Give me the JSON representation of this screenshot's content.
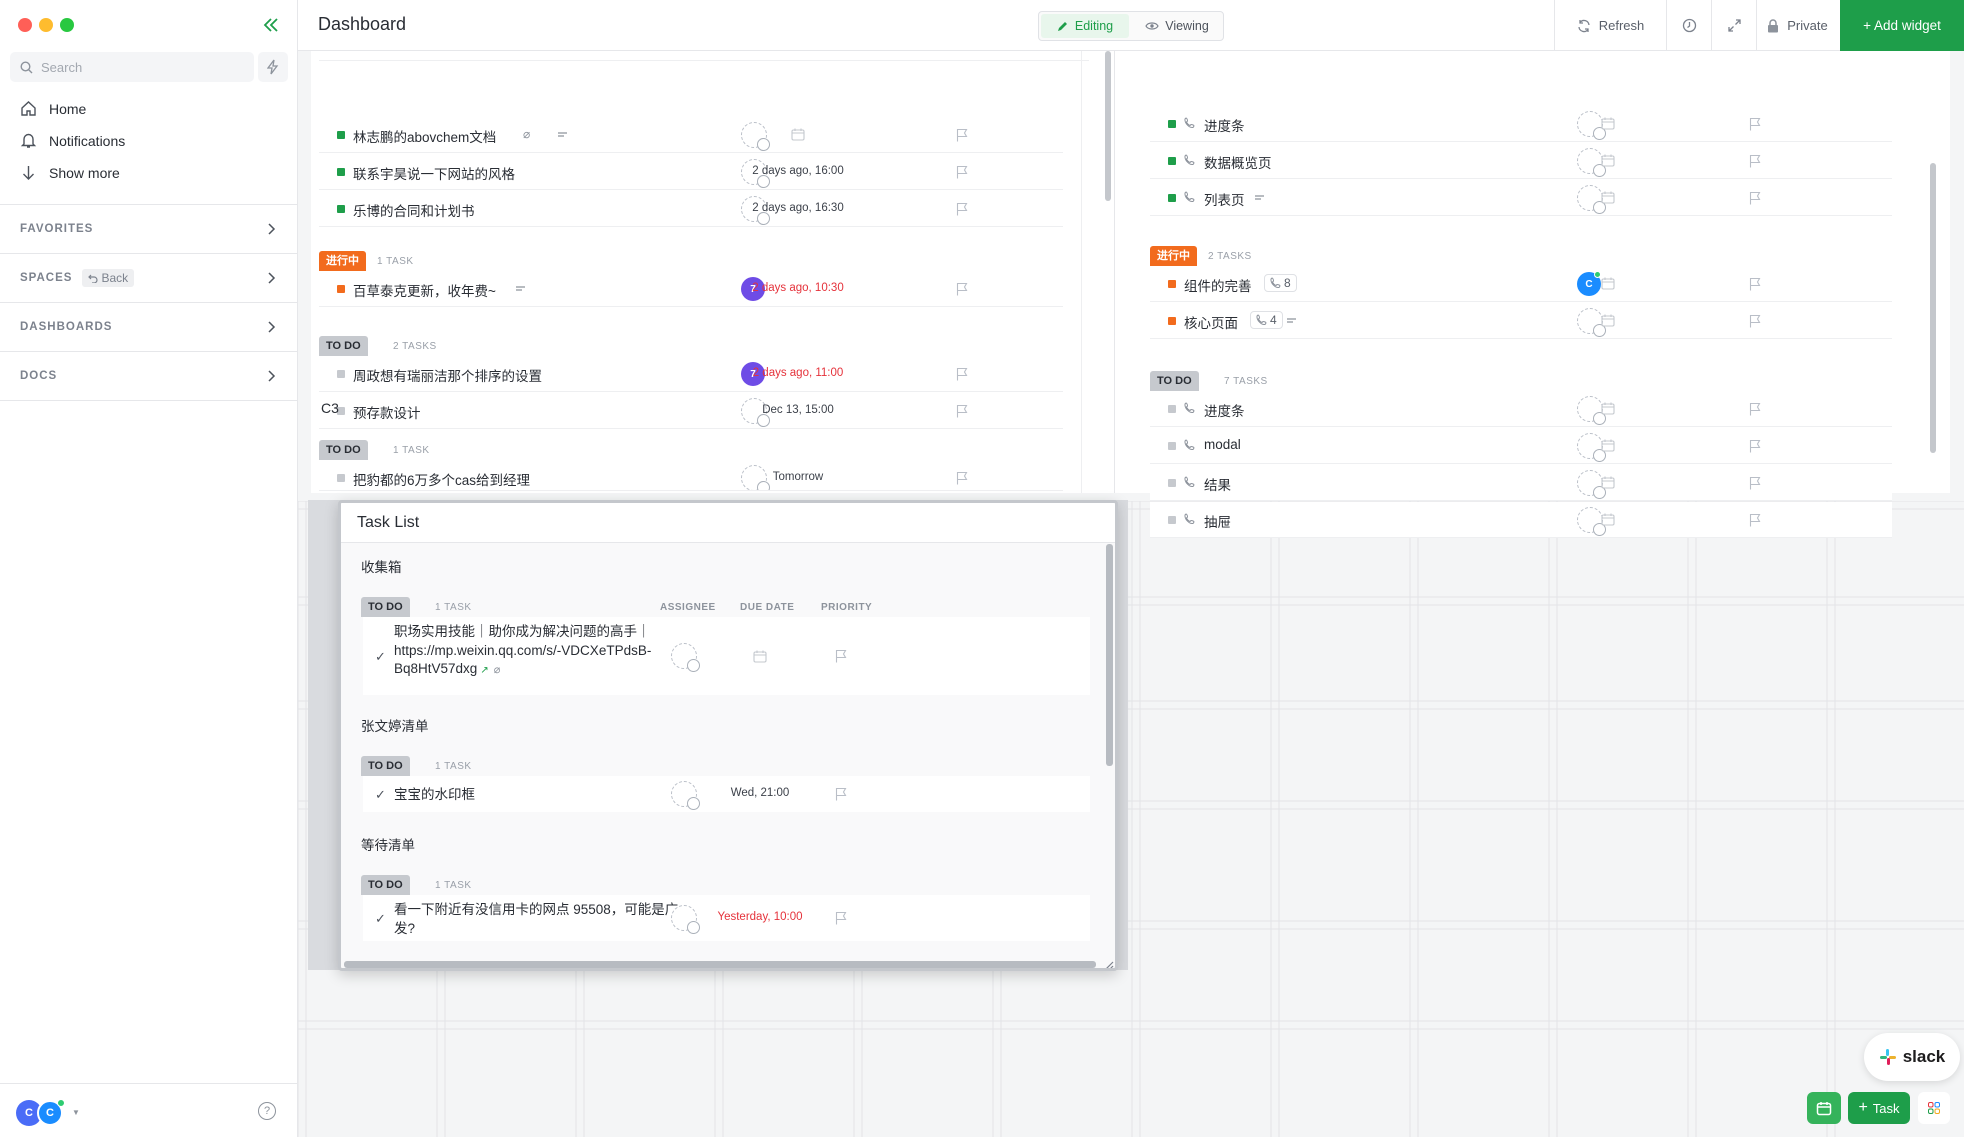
{
  "sidebar": {
    "search_placeholder": "Search",
    "nav": [
      {
        "label": "Home",
        "icon": "home-icon"
      },
      {
        "label": "Notifications",
        "icon": "bell-icon"
      },
      {
        "label": "Show more",
        "icon": "arrow-down-icon"
      }
    ],
    "sections": {
      "favorites": "FAVORITES",
      "spaces": "SPACES",
      "back": "Back",
      "dashboards": "DASHBOARDS",
      "docs": "DOCS"
    },
    "avatar_initial": "C"
  },
  "header": {
    "title": "Dashboard",
    "editing": "Editing",
    "viewing": "Viewing",
    "refresh": "Refresh",
    "private": "Private",
    "add_widget": "+ Add widget"
  },
  "left_widget": {
    "rows_top": [
      {
        "name": "林志鹏的abovchem文档",
        "date": ""
      },
      {
        "name": "联系宇昊说一下网站的风格",
        "date": "2 days ago, 16:00"
      },
      {
        "name": "乐博的合同和计划书",
        "date": "2 days ago, 16:30"
      }
    ],
    "in_progress": {
      "status": "进行中",
      "count": "1 TASK",
      "rows": [
        {
          "name": "百草泰克更新，收年费~",
          "date": "2 days ago, 10:30",
          "assignee": "7"
        }
      ]
    },
    "todo": {
      "status": "TO DO",
      "count": "2 TASKS",
      "rows": [
        {
          "name": "周政想有瑞丽洁那个排序的设置",
          "date": "2 days ago, 11:00",
          "assignee": "7"
        },
        {
          "name": "预存款设计",
          "date": "Dec 13, 15:00"
        }
      ]
    },
    "c3": {
      "title": "C3",
      "status": "TO DO",
      "count": "1 TASK",
      "partial_row": "把豹都的6万多个cas给到经理",
      "partial_date": "Tomorrow"
    }
  },
  "right_widget": {
    "rows_top": [
      {
        "name": "进度条"
      },
      {
        "name": "数据概览页"
      },
      {
        "name": "列表页"
      }
    ],
    "in_progress": {
      "status": "进行中",
      "count": "2 TASKS",
      "rows": [
        {
          "name": "组件的完善",
          "sub": "8",
          "assignee": "C"
        },
        {
          "name": "核心页面",
          "sub": "4"
        }
      ]
    },
    "todo": {
      "status": "TO DO",
      "count": "7 TASKS",
      "rows": [
        {
          "name": "进度条"
        },
        {
          "name": "modal"
        },
        {
          "name": "结果"
        },
        {
          "name": "抽屉"
        }
      ]
    }
  },
  "task_list": {
    "title": "Task List",
    "columns": {
      "assignee": "ASSIGNEE",
      "due": "DUE DATE",
      "priority": "PRIORITY"
    },
    "groups": [
      {
        "name": "收集箱",
        "status": "TO DO",
        "count": "1 TASK",
        "task_line1": "职场实用技能｜助你成为解决问题的高手｜",
        "task_line2": "https://mp.weixin.qq.com/s/-VDCXeTPdsB-",
        "task_line3": "Bq8HtV57dxg",
        "date": ""
      },
      {
        "name": "张文婷清单",
        "status": "TO DO",
        "count": "1 TASK",
        "task_line1": "宝宝的水印框",
        "date": "Wed, 21:00"
      },
      {
        "name": "等待清单",
        "status": "TO DO",
        "count": "1 TASK",
        "task_line1": "看一下附近有没信用卡的网点 95508，可能是广",
        "task_line2": "发?",
        "date": "Yesterday, 10:00"
      }
    ]
  },
  "bottom": {
    "slack": "slack",
    "task_button": "Task"
  },
  "colors": {
    "green": "#1e9e4a",
    "orange": "#f26b1d",
    "gray_status": "#c6c9ce",
    "purple": "#6e4ce6",
    "blue": "#1a8cff"
  }
}
